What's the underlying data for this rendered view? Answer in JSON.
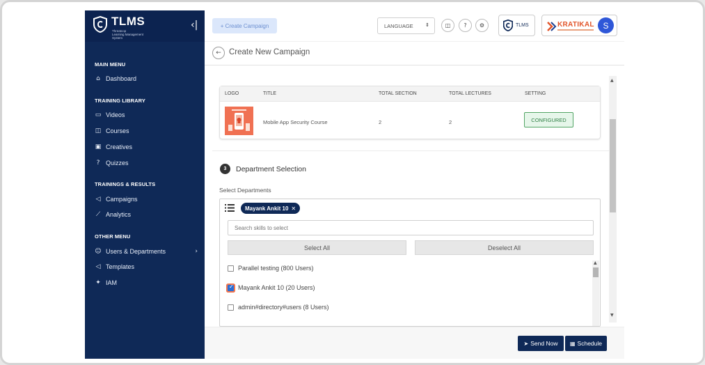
{
  "brand": {
    "title": "TLMS",
    "subtitle": "Threatcop\nLearning Management System",
    "collapse_icon": "‹|"
  },
  "sidebar": {
    "sections": [
      {
        "label": "MAIN MENU"
      },
      {
        "label": "TRAINING LIBRARY"
      },
      {
        "label": "TRAININGS & RESULTS"
      },
      {
        "label": "OTHER MENU"
      }
    ],
    "items": [
      {
        "label": "Dashboard",
        "icon": "home-icon"
      },
      {
        "label": "Videos",
        "icon": "video-icon"
      },
      {
        "label": "Courses",
        "icon": "book-icon"
      },
      {
        "label": "Creatives",
        "icon": "image-icon"
      },
      {
        "label": "Quizzes",
        "icon": "question-icon"
      },
      {
        "label": "Campaigns",
        "icon": "megaphone-icon"
      },
      {
        "label": "Analytics",
        "icon": "chart-line-icon"
      },
      {
        "label": "Users & Departments",
        "icon": "user-icon"
      },
      {
        "label": "Templates",
        "icon": "megaphone-icon"
      },
      {
        "label": "IAM",
        "icon": "tool-icon"
      }
    ]
  },
  "header": {
    "create_campaign": "+ Create Campaign",
    "language": "LANGUAGE",
    "tlms_badge": "TLMS",
    "org_name": "KRATIKAL",
    "avatar_letter": "S"
  },
  "page": {
    "title": "Create New Campaign"
  },
  "course_table": {
    "headers": [
      "LOGO",
      "TITLE",
      "TOTAL SECTION",
      "TOTAL LECTURES",
      "SETTING"
    ],
    "row": {
      "title": "Mobile App Security Course",
      "total_section": "2",
      "total_lectures": "2",
      "setting": "CONFIGURED"
    }
  },
  "department": {
    "step": "3",
    "title": "Department Selection",
    "select_label": "Select Departments",
    "chip": "Mayank Ankit 10",
    "search_placeholder": "Search skills to select",
    "select_all": "Select All",
    "deselect_all": "Deselect All",
    "options": [
      {
        "label": "Parallel testing (800 Users)",
        "checked": false
      },
      {
        "label": "Mayank Ankit 10 (20 Users)",
        "checked": true
      },
      {
        "label": "admin#directory#users (8 Users)",
        "checked": false
      }
    ]
  },
  "footer": {
    "send_now": "Send Now",
    "schedule": "Schedule"
  },
  "colors": {
    "sidebar_bg": "#0f2957",
    "accent": "#2a6fd6",
    "configured_green": "#52a565",
    "brand_orange": "#e2552a"
  }
}
